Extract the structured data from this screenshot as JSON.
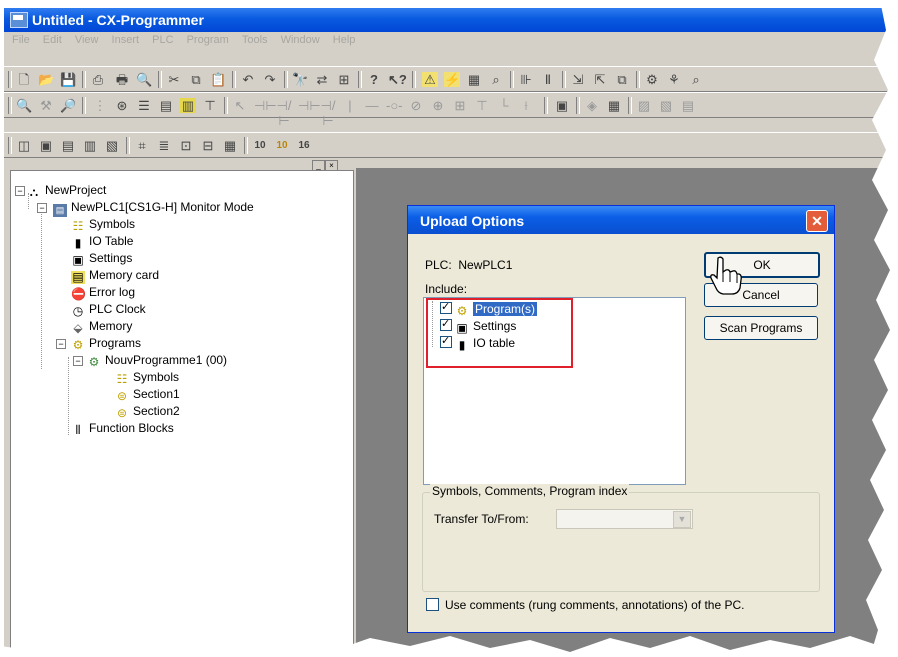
{
  "window": {
    "title": "Untitled - CX-Programmer"
  },
  "menu": [
    "File",
    "Edit",
    "View",
    "Insert",
    "PLC",
    "Program",
    "Tools",
    "Window",
    "Help"
  ],
  "tree": {
    "project": "NewProject",
    "plc": "NewPLC1[CS1G-H] Monitor Mode",
    "plc_children": [
      "Symbols",
      "IO Table",
      "Settings",
      "Memory card",
      "Error log",
      "PLC Clock",
      "Memory"
    ],
    "programs_label": "Programs",
    "program": "NouvProgramme1 (00)",
    "program_children": [
      "Symbols",
      "Section1",
      "Section2"
    ],
    "function_blocks": "Function Blocks"
  },
  "dialog": {
    "title": "Upload Options",
    "plc_label": "PLC:",
    "plc_value": "NewPLC1",
    "include_label": "Include:",
    "items": [
      {
        "label": "Program(s)",
        "checked": true,
        "selected": true
      },
      {
        "label": "Settings",
        "checked": true,
        "selected": false
      },
      {
        "label": "IO table",
        "checked": true,
        "selected": false
      }
    ],
    "buttons": {
      "ok": "OK",
      "cancel": "Cancel",
      "scan": "Scan Programs"
    },
    "group_title": "Symbols, Comments, Program index",
    "transfer_label": "Transfer To/From:",
    "use_comments": "Use comments (rung comments, annotations) of the PC."
  },
  "toolbar_row3_labels": [
    "10",
    "10",
    "16"
  ],
  "colors": {
    "titlebar": "#0a5ae0",
    "highlight": "#316ac5",
    "annotation": "#e0202a"
  }
}
